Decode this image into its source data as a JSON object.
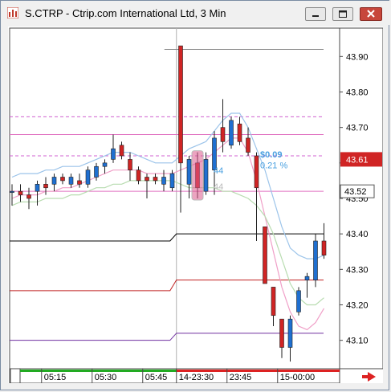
{
  "window": {
    "title": "S.CTRP - Ctrip.com International Ltd, 3 Min",
    "buttons": [
      "minimize",
      "maximize",
      "close"
    ]
  },
  "chart_data": {
    "type": "candlestick",
    "symbol": "S.CTRP",
    "interval": "3 Min",
    "ylim": [
      43.02,
      43.98
    ],
    "y_ticks": [
      "43.90",
      "43.80",
      "43.70",
      "43.60",
      "43.50",
      "43.40",
      "43.30",
      "43.20",
      "43.10"
    ],
    "x_ticks": [
      "05:15",
      "05:30",
      "05:45",
      "14-23:30",
      "23:45",
      "15-00:00"
    ],
    "last_price": "43.61",
    "bid_price": "43.52",
    "change_value": "$0.09",
    "change_percent": "0.21 %",
    "sizes": [
      "44",
      "44"
    ],
    "colors": {
      "up": "#1f6fd0",
      "down": "#d02424",
      "change_text": "#4aa0e0"
    },
    "candles": [
      {
        "o": 43.52,
        "h": 43.54,
        "l": 43.48,
        "c": 43.52
      },
      {
        "o": 43.52,
        "h": 43.54,
        "l": 43.49,
        "c": 43.51
      },
      {
        "o": 43.51,
        "h": 43.53,
        "l": 43.47,
        "c": 43.5
      },
      {
        "o": 43.52,
        "h": 43.55,
        "l": 43.48,
        "c": 43.54
      },
      {
        "o": 43.54,
        "h": 43.56,
        "l": 43.51,
        "c": 43.53
      },
      {
        "o": 43.54,
        "h": 43.57,
        "l": 43.52,
        "c": 43.56
      },
      {
        "o": 43.56,
        "h": 43.57,
        "l": 43.54,
        "c": 43.55
      },
      {
        "o": 43.54,
        "h": 43.57,
        "l": 43.53,
        "c": 43.56
      },
      {
        "o": 43.55,
        "h": 43.57,
        "l": 43.53,
        "c": 43.54
      },
      {
        "o": 43.54,
        "h": 43.59,
        "l": 43.53,
        "c": 43.58
      },
      {
        "o": 43.56,
        "h": 43.6,
        "l": 43.55,
        "c": 43.59
      },
      {
        "o": 43.59,
        "h": 43.61,
        "l": 43.57,
        "c": 43.6
      },
      {
        "o": 43.61,
        "h": 43.68,
        "l": 43.6,
        "c": 43.64
      },
      {
        "o": 43.65,
        "h": 43.66,
        "l": 43.61,
        "c": 43.62
      },
      {
        "o": 43.61,
        "h": 43.63,
        "l": 43.55,
        "c": 43.58
      },
      {
        "o": 43.58,
        "h": 43.59,
        "l": 43.54,
        "c": 43.55
      },
      {
        "o": 43.56,
        "h": 43.57,
        "l": 43.5,
        "c": 43.55
      },
      {
        "o": 43.56,
        "h": 43.57,
        "l": 43.54,
        "c": 43.55
      },
      {
        "o": 43.54,
        "h": 43.58,
        "l": 43.52,
        "c": 43.56
      },
      {
        "o": 43.53,
        "h": 43.58,
        "l": 43.52,
        "c": 43.57
      },
      {
        "o": 43.93,
        "h": 43.93,
        "l": 43.46,
        "c": 43.6
      },
      {
        "o": 43.54,
        "h": 43.62,
        "l": 43.5,
        "c": 43.61
      },
      {
        "o": 43.6,
        "h": 43.63,
        "l": 43.5,
        "c": 43.53
      },
      {
        "o": 43.52,
        "h": 43.63,
        "l": 43.51,
        "c": 43.61
      },
      {
        "o": 43.58,
        "h": 43.69,
        "l": 43.51,
        "c": 43.67
      },
      {
        "o": 43.7,
        "h": 43.78,
        "l": 43.63,
        "c": 43.66
      },
      {
        "o": 43.65,
        "h": 43.73,
        "l": 43.64,
        "c": 43.72
      },
      {
        "o": 43.71,
        "h": 43.73,
        "l": 43.65,
        "c": 43.66
      },
      {
        "o": 43.67,
        "h": 43.7,
        "l": 43.62,
        "c": 43.63
      },
      {
        "o": 43.62,
        "h": 43.63,
        "l": 43.38,
        "c": 43.53
      },
      {
        "o": 43.42,
        "h": 43.42,
        "l": 43.26,
        "c": 43.26
      },
      {
        "o": 43.25,
        "h": 43.25,
        "l": 43.14,
        "c": 43.17
      },
      {
        "o": 43.16,
        "h": 43.16,
        "l": 43.05,
        "c": 43.08
      },
      {
        "o": 43.08,
        "h": 43.17,
        "l": 43.04,
        "c": 43.16
      },
      {
        "o": 43.18,
        "h": 43.25,
        "l": 43.17,
        "c": 43.24
      },
      {
        "o": 43.27,
        "h": 43.29,
        "l": 43.22,
        "c": 43.28
      },
      {
        "o": 43.27,
        "h": 43.4,
        "l": 43.25,
        "c": 43.38
      },
      {
        "o": 43.38,
        "h": 43.43,
        "l": 43.33,
        "c": 43.34
      }
    ],
    "bollinger_upper": [
      43.56,
      43.57,
      43.57,
      43.57,
      43.58,
      43.58,
      43.59,
      43.59,
      43.59,
      43.6,
      43.61,
      43.62,
      43.63,
      43.63,
      43.63,
      43.62,
      43.61,
      43.6,
      43.6,
      43.6,
      43.62,
      43.64,
      43.65,
      43.66,
      43.69,
      43.72,
      43.74,
      43.74,
      43.7,
      43.64,
      43.58,
      43.5,
      43.42,
      43.36,
      43.34,
      43.33,
      43.33,
      43.34
    ],
    "bollinger_middle": [
      43.5,
      43.51,
      43.51,
      43.51,
      43.52,
      43.52,
      43.53,
      43.53,
      43.54,
      43.55,
      43.56,
      43.57,
      43.58,
      43.58,
      43.58,
      43.58,
      43.57,
      43.57,
      43.57,
      43.57,
      43.58,
      43.59,
      43.6,
      43.61,
      43.63,
      43.65,
      43.67,
      43.67,
      43.63,
      43.55,
      43.45,
      43.35,
      43.25,
      43.18,
      43.14,
      43.13,
      43.15,
      43.19
    ],
    "bollinger_lower": [
      43.48,
      43.49,
      43.49,
      43.49,
      43.5,
      43.5,
      43.5,
      43.51,
      43.51,
      43.52,
      43.53,
      43.53,
      43.54,
      43.54,
      43.55,
      43.55,
      43.55,
      43.55,
      43.55,
      43.55,
      43.54,
      43.53,
      43.53,
      43.53,
      43.53,
      43.52,
      43.52,
      43.51,
      43.5,
      43.48,
      43.45,
      43.4,
      43.33,
      43.26,
      43.22,
      43.2,
      43.2,
      43.22
    ],
    "levels": [
      {
        "price": 43.92,
        "color": "#8c8c8c",
        "style": "solid"
      },
      {
        "price": 43.73,
        "color": "#d060d0",
        "style": "dash"
      },
      {
        "price": 43.68,
        "color": "#e070c0",
        "style": "solid"
      },
      {
        "price": 43.62,
        "color": "#d060d0",
        "style": "dash"
      },
      {
        "price": 43.52,
        "color": "#e070c0",
        "style": "solid"
      }
    ],
    "pivot_steps": [
      {
        "before": 43.38,
        "after": 43.4,
        "color": "#000000"
      },
      {
        "before": 43.24,
        "after": 43.27,
        "color": "#c02020"
      },
      {
        "before": 43.1,
        "after": 43.12,
        "color": "#7030a0"
      }
    ],
    "session_break_index": 20
  }
}
